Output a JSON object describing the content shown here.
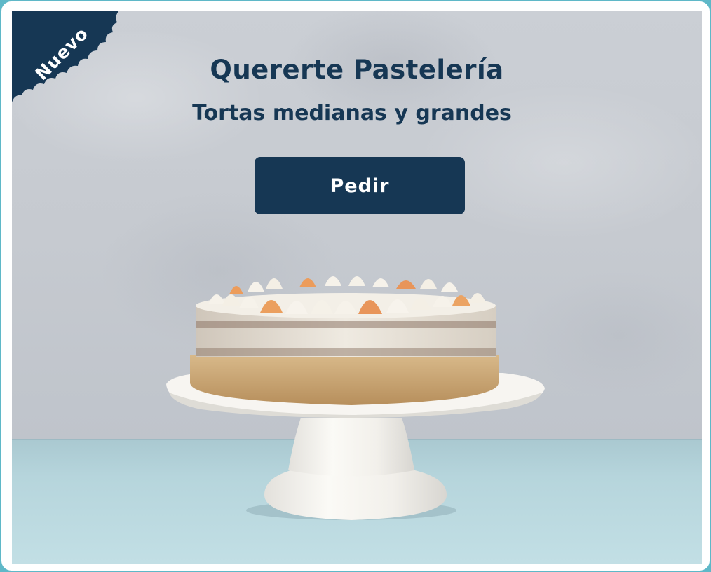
{
  "badge": {
    "label": "Nuevo"
  },
  "hero": {
    "title": "Quererte Pastelería",
    "subtitle": "Tortas medianas y grandes",
    "cta_label": "Pedir",
    "image_subject": "cake-on-stand"
  },
  "colors": {
    "brand_navy": "#163754",
    "frame_teal": "#5fb8c8",
    "wall_gray": "#c6cad0",
    "table_blue": "#b6d5dc"
  }
}
